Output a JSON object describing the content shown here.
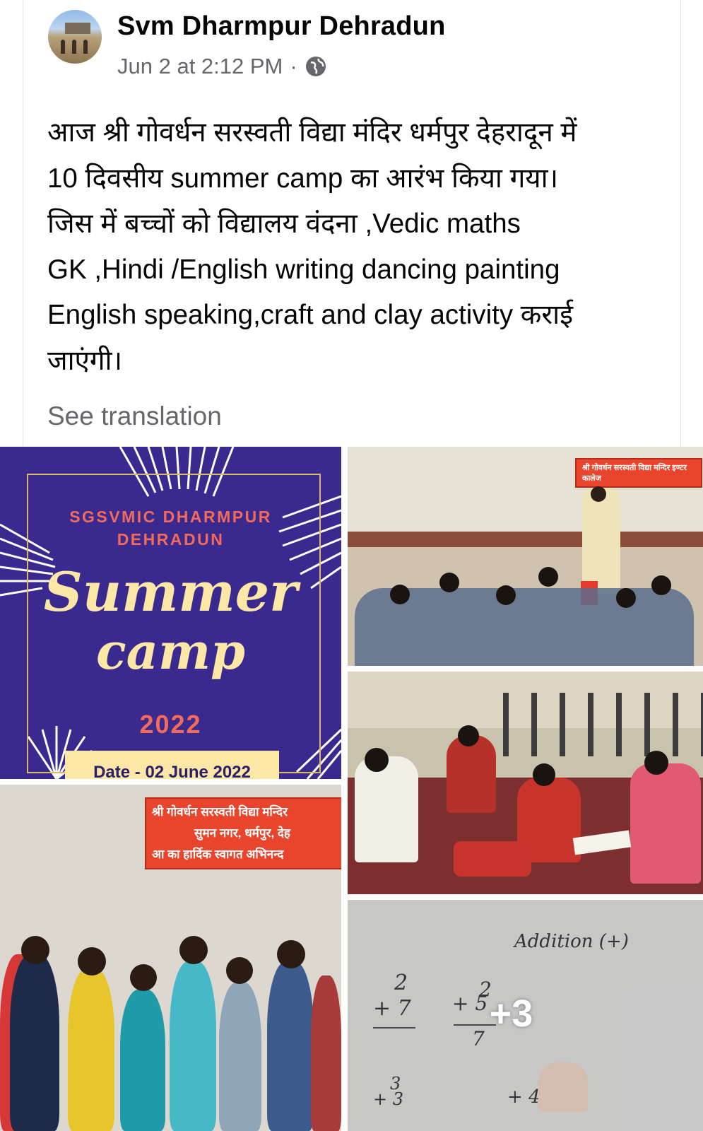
{
  "post": {
    "author": "Svm Dharmpur Dehradun",
    "timestamp": "Jun 2 at 2:12 PM",
    "separator": "·",
    "privacy_icon": "globe-icon",
    "text": "आज श्री गोवर्धन सरस्वती विद्या मंदिर धर्मपुर देहरादून में\n10 दिवसीय summer camp का आरंभ किया गया।\nजिस में बच्चों को विद्यालय वंदना ,Vedic maths\nGK ,Hindi /English writing dancing painting\nEnglish speaking,craft and clay activity कराई\nजाएंगी।",
    "see_translation": "See translation"
  },
  "photos": {
    "poster": {
      "line1": "SGSVMIC DHARMPUR",
      "line2": "DEHRADUN",
      "title1": "Summer",
      "title2": "camp",
      "year": "2022",
      "date": "Date - 02 June 2022"
    },
    "banner_classroom": "श्री गोवर्धन सरस्वती विद्या मन्दिर इण्टर कालेज",
    "banner_kids": {
      "line1": "श्री गोवर्धन सरस्वती विद्या मन्दिर",
      "line2": "सुमन नगर, धर्मपुर, देह",
      "line3": "आ का हार्दिक स्वागत अभिनन्द"
    },
    "board": {
      "title": "Addition (+)",
      "sums": [
        "2",
        "+ 7",
        "2",
        "+ 5",
        "7",
        "3",
        "+ 3",
        "+ 4"
      ]
    },
    "more_count": "+3"
  },
  "colors": {
    "poster_bg": "#3a2a8f",
    "poster_accent": "#f26b5b",
    "poster_title": "#fce7a6",
    "meta_text": "#65676b"
  }
}
